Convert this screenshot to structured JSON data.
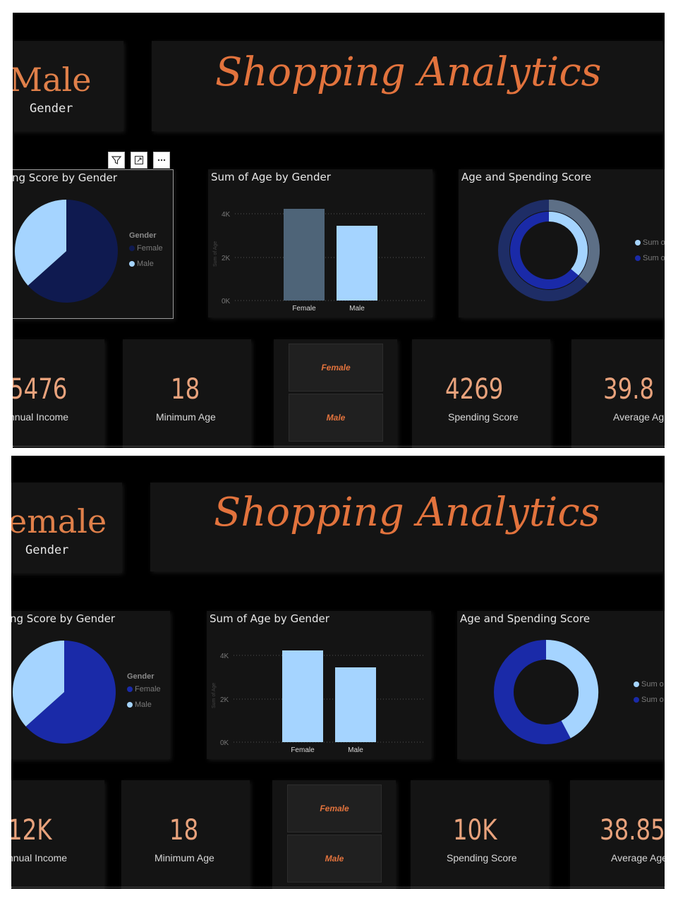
{
  "dashboards": [
    {
      "id": "male",
      "gender_value": "Male",
      "gender_label": "Gender",
      "title": "Shopping Analytics",
      "pie": {
        "title": "ng Score by Gender",
        "legend_title": "Gender",
        "legend": [
          "Female",
          "Male"
        ],
        "colors": [
          "#0f1a50",
          "#a5d4ff"
        ],
        "values": [
          57,
          43
        ]
      },
      "bar": {
        "title": "Sum of Age by Gender",
        "categories": [
          "Female",
          "Male"
        ],
        "values": [
          4200,
          3500
        ],
        "ticks": [
          "0K",
          "2K",
          "4K"
        ],
        "ylabel": "Sum of Age",
        "colors": [
          "#4e6478",
          "#a5d4ff"
        ]
      },
      "donut": {
        "title": "Age and Spending Score",
        "legend": [
          "Sum o",
          "Sum o"
        ],
        "colors": [
          "#a5d4ff",
          "#1a2aa8"
        ]
      },
      "kpis": {
        "income_value": "5476",
        "income_label": "nnual Income",
        "min_age_value": "18",
        "min_age_label": "Minimum Age",
        "spending_value": "4269",
        "spending_label": "Spending Score",
        "avg_age_value": "39.8",
        "avg_age_label": "Average Ag"
      },
      "slicer": [
        "Female",
        "Male"
      ]
    },
    {
      "id": "female",
      "gender_value": "emale",
      "gender_label": "Gender",
      "title": "Shopping Analytics",
      "pie": {
        "title": "ng Score by Gender",
        "legend_title": "Gender",
        "legend": [
          "Female",
          "Male"
        ],
        "colors": [
          "#1a2aa8",
          "#a5d4ff"
        ],
        "values": [
          57,
          43
        ]
      },
      "bar": {
        "title": "Sum of Age by Gender",
        "categories": [
          "Female",
          "Male"
        ],
        "values": [
          4200,
          3500
        ],
        "ticks": [
          "0K",
          "2K",
          "4K"
        ],
        "ylabel": "Sum of Age",
        "colors": [
          "#a5d4ff",
          "#a5d4ff"
        ]
      },
      "donut": {
        "title": "Age and Spending Score",
        "legend": [
          "Sum o",
          "Sum o"
        ],
        "colors": [
          "#a5d4ff",
          "#1a2aa8"
        ]
      },
      "kpis": {
        "income_value": "12K",
        "income_label": "nnual Income",
        "min_age_value": "18",
        "min_age_label": "Minimum Age",
        "spending_value": "10K",
        "spending_label": "Spending Score",
        "avg_age_value": "38.85",
        "avg_age_label": "Average Age"
      },
      "slicer": [
        "Female",
        "Male"
      ]
    }
  ],
  "chart_data": [
    {
      "type": "pie",
      "title": "ng Score by Gender",
      "categories": [
        "Female",
        "Male"
      ],
      "values": [
        57,
        43
      ]
    },
    {
      "type": "bar",
      "title": "Sum of Age by Gender",
      "categories": [
        "Female",
        "Male"
      ],
      "values": [
        4200,
        3500
      ],
      "ylim": [
        0,
        4500
      ]
    },
    {
      "type": "pie",
      "title": "Age and Spending Score",
      "series": [
        {
          "name": "Sum o",
          "values": [
            57,
            43
          ]
        }
      ]
    }
  ],
  "visual_header": {
    "icons": [
      "filter-icon",
      "focus-mode-icon",
      "more-options-icon"
    ]
  }
}
